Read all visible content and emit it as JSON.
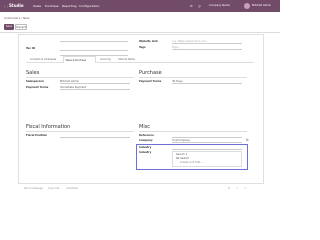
{
  "navbar": {
    "app": "Studio",
    "menu": [
      "Sales",
      "Purchase",
      "Reporting",
      "Configuration"
    ],
    "company": "Company Name",
    "user": "Mitchell Admin"
  },
  "breadcrumb": "Customers / New",
  "actions": {
    "save": "Save",
    "discard": "Discard"
  },
  "top_fields": {
    "tax_id_label": "Tax ID",
    "website_label": "Website Link",
    "website_placeholder": "e.g. https://www.odoo.com",
    "tags_label": "Tags",
    "tags_placeholder": "Tags..."
  },
  "tabs": [
    "Contacts & Addresses",
    "Sales & Purchase",
    "Invoicing",
    "Internal Notes"
  ],
  "sales": {
    "title": "Sales",
    "salesperson_label": "Salesperson",
    "salesperson_value": "Mitchell Admin",
    "payment_terms_label": "Payment Terms",
    "payment_terms_value": "Immediate Payment"
  },
  "purchase": {
    "title": "Purchase",
    "payment_terms_label": "Payment Terms",
    "payment_terms_value": "30 Days"
  },
  "fiscal": {
    "title": "Fiscal Information",
    "fiscal_position_label": "Fiscal Position"
  },
  "misc": {
    "title": "Misc",
    "reference_label": "Reference",
    "company_label": "Company",
    "company_value": "YourCompany",
    "field_a_label": "Industry",
    "field_b_label": "Industry",
    "dropdown_options": [
      "Search 1",
      "Re-Search",
      "Create and Edit..."
    ]
  },
  "chatter": [
    "Send message",
    "Log note",
    "Activities"
  ]
}
